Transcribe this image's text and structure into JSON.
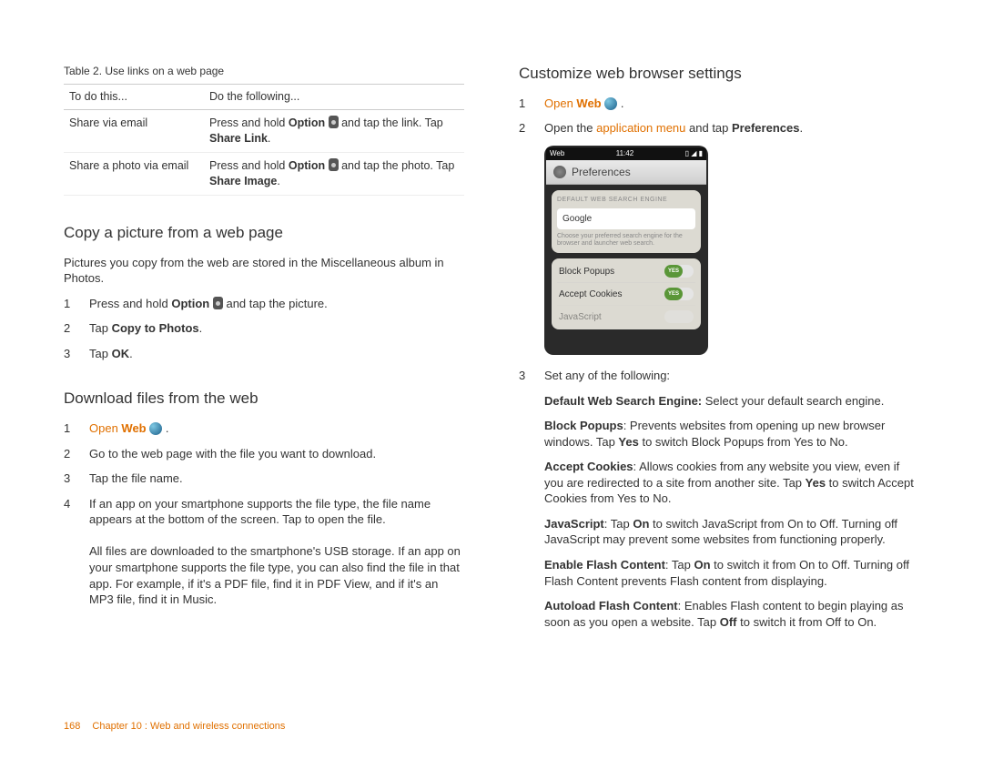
{
  "table": {
    "caption": "Table 2.  Use links on a web page",
    "headers": [
      "To do this...",
      "Do the following..."
    ],
    "rows": [
      {
        "action": "Share via email",
        "pre": "Press and hold ",
        "opt": "Option",
        "post": " and tap the link. Tap ",
        "target": "Share Link",
        "tail": "."
      },
      {
        "action": "Share a photo via email",
        "pre": "Press and hold ",
        "opt": "Option",
        "post": " and tap the photo. Tap ",
        "target": "Share Image",
        "tail": "."
      }
    ]
  },
  "copy_section": {
    "title": "Copy a picture from a web page",
    "intro": "Pictures you copy from the web are stored in the Miscellaneous album in Photos.",
    "steps": [
      {
        "pre": "Press and hold ",
        "opt": "Option",
        "post": " and tap the picture."
      },
      {
        "pre": "Tap ",
        "bold": "Copy to Photos",
        "post": "."
      },
      {
        "pre": "Tap ",
        "bold": "OK",
        "post": "."
      }
    ]
  },
  "download_section": {
    "title": "Download files from the web",
    "steps": [
      {
        "link": "Open ",
        "linkbold": "Web",
        "post": " ."
      },
      {
        "text": "Go to the web page with the file you want to download."
      },
      {
        "text": "Tap the file name."
      },
      {
        "text": "If an app on your smartphone supports the file type, the file name appears at the bottom of the screen. Tap to open the file.",
        "extra": "All files are downloaded to the smartphone's USB storage. If an app on your smartphone supports the file type, you can also find the file in that app. For example, if it's a PDF file, find it in PDF View, and if it's an MP3 file, find it in Music."
      }
    ]
  },
  "customize_section": {
    "title": "Customize web browser settings",
    "step1": {
      "link": "Open ",
      "linkbold": "Web",
      "post": " ."
    },
    "step2": {
      "pre": "Open the ",
      "link": "application menu",
      "post": " and tap ",
      "bold": "Preferences",
      "tail": "."
    },
    "step3_intro": "Set any of the following:",
    "items": [
      {
        "label": "Default Web Search Engine:",
        "text": " Select your default search engine."
      },
      {
        "label": "Block Popups",
        "sep": ": ",
        "text_pre": "Prevents websites from opening up new browser windows. Tap ",
        "bold": "Yes",
        "text_post": " to switch Block Popups from Yes to No."
      },
      {
        "label": "Accept Cookies",
        "sep": ": ",
        "text_pre": "Allows cookies from any website you view, even if you are redirected to a site from another site. Tap ",
        "bold": "Yes",
        "text_post": " to switch Accept Cookies from Yes to No."
      },
      {
        "label": "JavaScript",
        "sep": ": ",
        "text_pre": "Tap ",
        "bold": "On",
        "text_post": " to switch JavaScript from On to Off. Turning off JavaScript may prevent some websites from functioning properly."
      },
      {
        "label": "Enable Flash Content",
        "sep": ": ",
        "text_pre": "Tap ",
        "bold": "On",
        "text_post": " to switch it from On to Off. Turning off Flash Content prevents Flash content from displaying."
      },
      {
        "label": "Autoload Flash Content",
        "sep": ": ",
        "text_pre": "Enables Flash content to begin playing as soon as you open a website. Tap ",
        "bold": "Off",
        "text_post": " to switch it from Off to On."
      }
    ]
  },
  "screenshot": {
    "app": "Web",
    "time": "11:42",
    "header": "Preferences",
    "panel1_title": "DEFAULT WEB SEARCH ENGINE",
    "panel1_value": "Google",
    "panel1_hint": "Choose your preferred search engine for the browser and launcher web search.",
    "rows": [
      {
        "label": "Block Popups",
        "state": "YES"
      },
      {
        "label": "Accept Cookies",
        "state": "YES"
      },
      {
        "label": "JavaScript",
        "state": ""
      }
    ]
  },
  "footer": {
    "page": "168",
    "chapter": "Chapter 10 : Web and wireless connections"
  }
}
